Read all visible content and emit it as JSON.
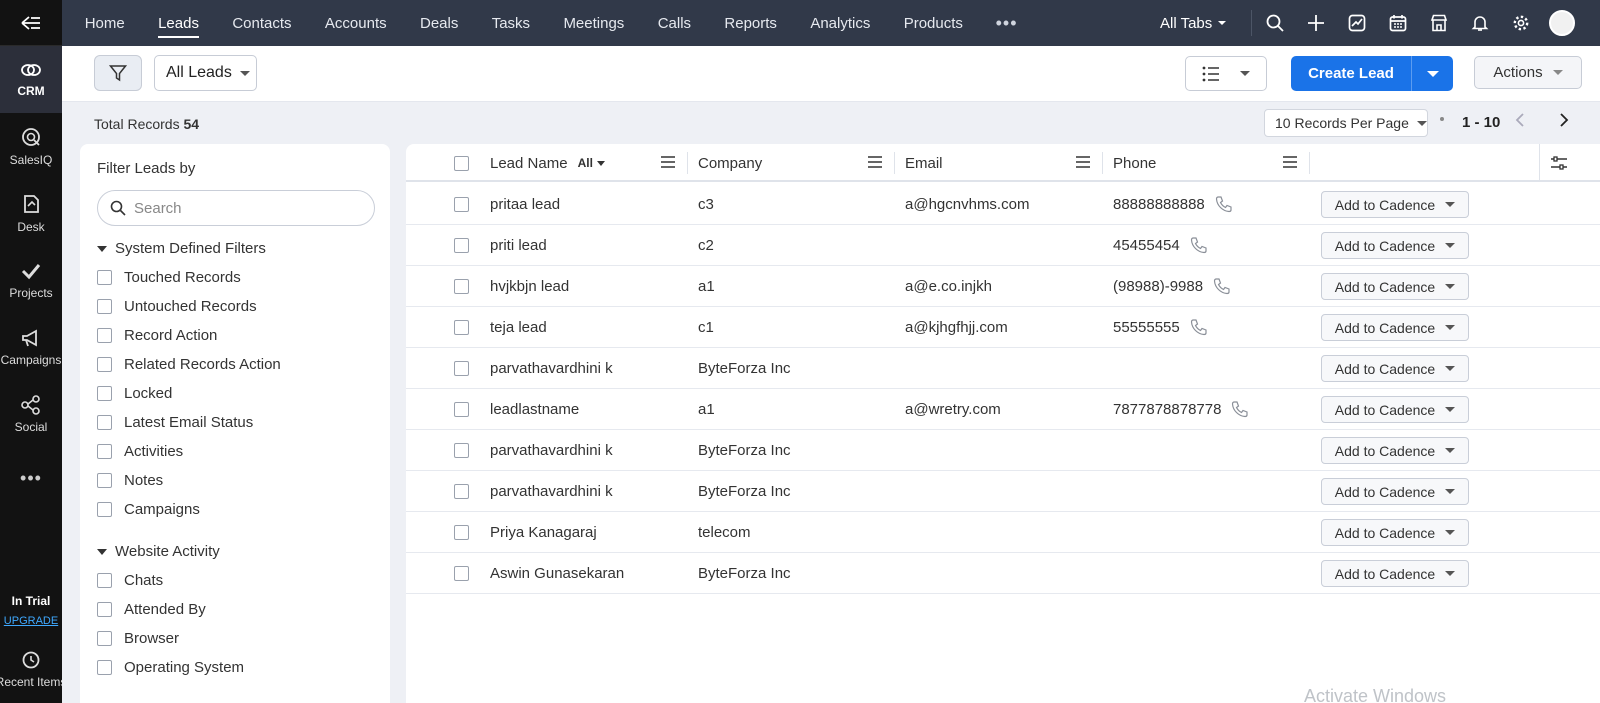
{
  "rail": {
    "items": [
      {
        "label": "CRM",
        "icon": "crm-icon"
      },
      {
        "label": "SalesIQ",
        "icon": "salesiq-icon"
      },
      {
        "label": "Desk",
        "icon": "desk-icon"
      },
      {
        "label": "Projects",
        "icon": "projects-icon"
      },
      {
        "label": "Campaigns",
        "icon": "campaigns-icon"
      },
      {
        "label": "Social",
        "icon": "social-icon"
      }
    ],
    "more": "•••",
    "trial": "In Trial",
    "upgrade": "UPGRADE",
    "recent": "Recent Items"
  },
  "nav": {
    "tabs": [
      "Home",
      "Leads",
      "Contacts",
      "Accounts",
      "Deals",
      "Tasks",
      "Meetings",
      "Calls",
      "Reports",
      "Analytics",
      "Products"
    ],
    "active_tab": "Leads",
    "more": "•••",
    "all_tabs": "All Tabs"
  },
  "toolbar": {
    "view": "All Leads",
    "create": "Create Lead",
    "actions": "Actions"
  },
  "records": {
    "total_label": "Total Records",
    "total": "54",
    "per_page": "10 Records Per Page",
    "range": "1 - 10"
  },
  "filters": {
    "title": "Filter Leads by",
    "search_placeholder": "Search",
    "system_title": "System Defined Filters",
    "system_items": [
      "Touched Records",
      "Untouched Records",
      "Record Action",
      "Related Records Action",
      "Locked",
      "Latest Email Status",
      "Activities",
      "Notes",
      "Campaigns"
    ],
    "website_title": "Website Activity",
    "website_items": [
      "Chats",
      "Attended By",
      "Browser",
      "Operating System"
    ]
  },
  "table": {
    "columns": [
      "Lead Name",
      "Company",
      "Email",
      "Phone"
    ],
    "all_chip": "All",
    "cadence_label": "Add to Cadence",
    "rows": [
      {
        "name": "pritaa lead",
        "company": "c3",
        "email": "a@hgcnvhms.com",
        "phone": "88888888888"
      },
      {
        "name": "priti lead",
        "company": "c2",
        "email": "",
        "phone": "45455454"
      },
      {
        "name": "hvjkbjn lead",
        "company": "a1",
        "email": "a@e.co.injkh",
        "phone": "(98988)-9988"
      },
      {
        "name": "teja lead",
        "company": "c1",
        "email": "a@kjhgfhjj.com",
        "phone": "55555555"
      },
      {
        "name": "parvathavardhini k",
        "company": "ByteForza Inc",
        "email": "",
        "phone": ""
      },
      {
        "name": "leadlastname",
        "company": "a1",
        "email": "a@wretry.com",
        "phone": "7877878878778"
      },
      {
        "name": "parvathavardhini k",
        "company": "ByteForza Inc",
        "email": "",
        "phone": ""
      },
      {
        "name": "parvathavardhini k",
        "company": "ByteForza Inc",
        "email": "",
        "phone": ""
      },
      {
        "name": "Priya Kanagaraj",
        "company": "telecom",
        "email": "",
        "phone": ""
      },
      {
        "name": "Aswin Gunasekaran",
        "company": "ByteForza Inc",
        "email": "",
        "phone": ""
      }
    ]
  },
  "watermark": "Activate Windows",
  "colors": {
    "primary": "#1a73e8",
    "nav_bg": "#313949",
    "rail_bg": "#121212"
  }
}
